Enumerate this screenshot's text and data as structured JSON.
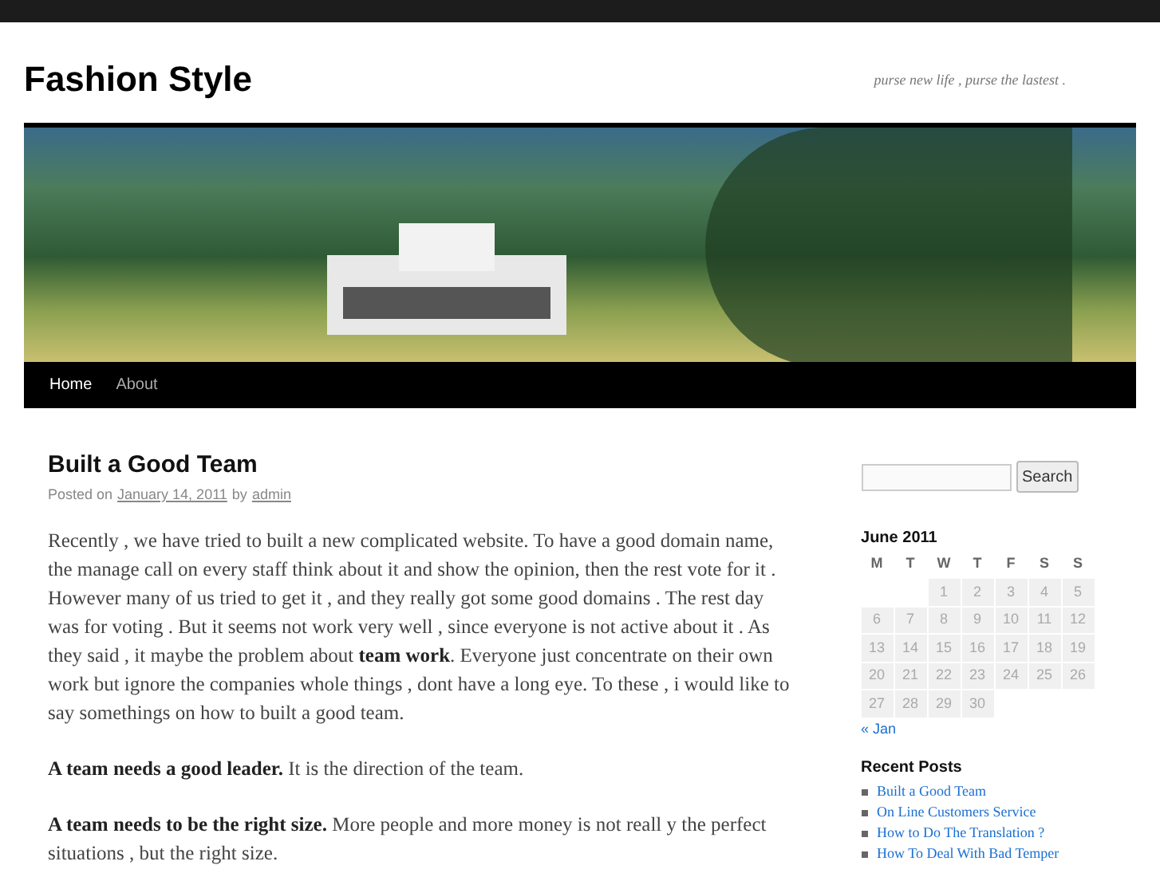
{
  "site": {
    "title": "Fashion Style",
    "tagline": "purse new life , purse the lastest ."
  },
  "nav": [
    {
      "label": "Home",
      "selected": true
    },
    {
      "label": "About",
      "selected": false
    }
  ],
  "post": {
    "title": "Built a Good Team",
    "meta": {
      "prefix": "Posted on",
      "date": "January 14, 2011",
      "by": "by",
      "author": "admin"
    },
    "paragraphs": [
      "Recently , we have tried to built a new complicated website. To have a good domain name, the manage call on every staff think about it and show the opinion, then the rest vote for it . However many of us tried to get it , and they really got some good domains . The rest day was for voting . But it seems not work very well , since everyone is not active about it . As they said , it maybe the problem about **team work**. Everyone just concentrate on their own work but ignore the companies whole things , dont have a long eye. To these , i would like to say somethings on how to built a good team.",
      "**A team needs a good leader.** It is the direction of the team.",
      "**A team needs to be the right size.** More people and more money is not reall y the perfect situations , but the right size."
    ]
  },
  "sidebar": {
    "search_button": "Search",
    "calendar": {
      "title": "June 2011",
      "weekdays": [
        "M",
        "T",
        "W",
        "T",
        "F",
        "S",
        "S"
      ],
      "weeks": [
        [
          "1",
          "2",
          "3",
          "4",
          "5"
        ],
        [
          "6",
          "7",
          "8",
          "9",
          "10",
          "11",
          "12"
        ],
        [
          "13",
          "14",
          "15",
          "16",
          "17",
          "18",
          "19"
        ],
        [
          "20",
          "21",
          "22",
          "23",
          "24",
          "25",
          "26"
        ],
        [
          "27",
          "28",
          "29",
          "30"
        ]
      ],
      "prev_link": "« Jan"
    },
    "recent_posts": {
      "title": "Recent Posts",
      "items": [
        "Built a Good Team",
        "On Line Customers Service",
        "How to Do The Translation ?",
        "How To Deal With Bad Temper"
      ]
    }
  }
}
